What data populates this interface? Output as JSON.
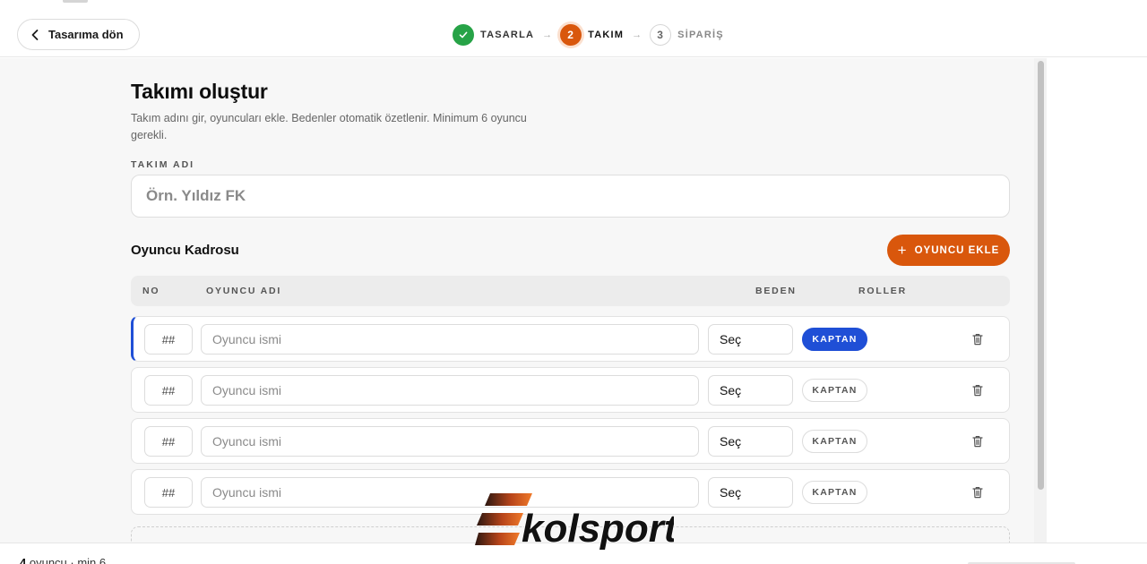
{
  "header": {
    "back_label": "Tasarıma dön",
    "steps": [
      {
        "number": "✓",
        "label": "TASARLA",
        "state": "done"
      },
      {
        "number": "2",
        "label": "TAKIM",
        "state": "active"
      },
      {
        "number": "3",
        "label": "SİPARİŞ",
        "state": "todo"
      }
    ],
    "arrow_glyph": "→"
  },
  "main": {
    "title": "Takımı oluştur",
    "description": "Takım adını gir, oyuncuları ekle. Bedenler otomatik özetlenir. Minimum 6 oyuncu gerekli.",
    "team_name": {
      "label": "TAKIM ADI",
      "placeholder": "Örn. Yıldız FK",
      "value": ""
    },
    "roster": {
      "title": "Oyuncu Kadrosu",
      "add_label": "OYUNCU EKLE",
      "columns": [
        "NO",
        "OYUNCU ADI",
        "BEDEN",
        "ROLLER"
      ],
      "rows": [
        {
          "no": "##",
          "name_placeholder": "Oyuncu ismi",
          "size": "Seç",
          "role": "KAPTAN",
          "role_active": true
        },
        {
          "no": "##",
          "name_placeholder": "Oyuncu ismi",
          "size": "Seç",
          "role": "KAPTAN",
          "role_active": false
        },
        {
          "no": "##",
          "name_placeholder": "Oyuncu ismi",
          "size": "Seç",
          "role": "KAPTAN",
          "role_active": false
        },
        {
          "no": "##",
          "name_placeholder": "Oyuncu ismi",
          "size": "Seç",
          "role": "KAPTAN",
          "role_active": false
        }
      ]
    }
  },
  "footer": {
    "player_count": "4",
    "count_suffix": "oyuncu · min 6"
  },
  "brand": {
    "logo_text": "kolsport",
    "accent": "#d9570c",
    "success": "#27a347",
    "captain_blue": "#1f4fd6"
  }
}
